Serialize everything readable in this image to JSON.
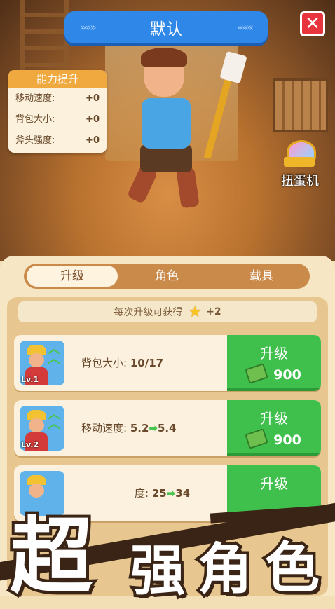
{
  "header": {
    "title": "默认",
    "chevrons_left": "»»»",
    "chevrons_right": "«««",
    "close_glyph": "✕"
  },
  "stats": {
    "title": "能力提升",
    "rows": [
      {
        "label": "移动速度:",
        "value": "+0"
      },
      {
        "label": "背包大小:",
        "value": "+0"
      },
      {
        "label": "斧头强度:",
        "value": "+0"
      }
    ]
  },
  "gacha": {
    "label": "扭蛋机"
  },
  "tabs": [
    {
      "label": "升级",
      "active": true
    },
    {
      "label": "角色",
      "active": false
    },
    {
      "label": "载具",
      "active": false
    }
  ],
  "hint": {
    "text": "每次升级可获得",
    "reward": "+2",
    "icon": "star-icon"
  },
  "upgrades": [
    {
      "level": "Lv.1",
      "label": "背包大小:",
      "value": "10/17",
      "button": "升级",
      "cost": "900"
    },
    {
      "level": "Lv.2",
      "label": "移动速度:",
      "from": "5.2",
      "to": "5.4",
      "arrow": "➡",
      "button": "升级",
      "cost": "900"
    },
    {
      "label_visible": "度:",
      "from": "25",
      "to": "34",
      "arrow": "➡",
      "button": "升级"
    }
  ],
  "banner": {
    "chars": [
      "超",
      "强",
      "角",
      "色"
    ]
  },
  "colors": {
    "accent_blue": "#2f87e8",
    "green": "#3fc04c",
    "close_red": "#e8343d",
    "orange": "#f0a93f"
  }
}
